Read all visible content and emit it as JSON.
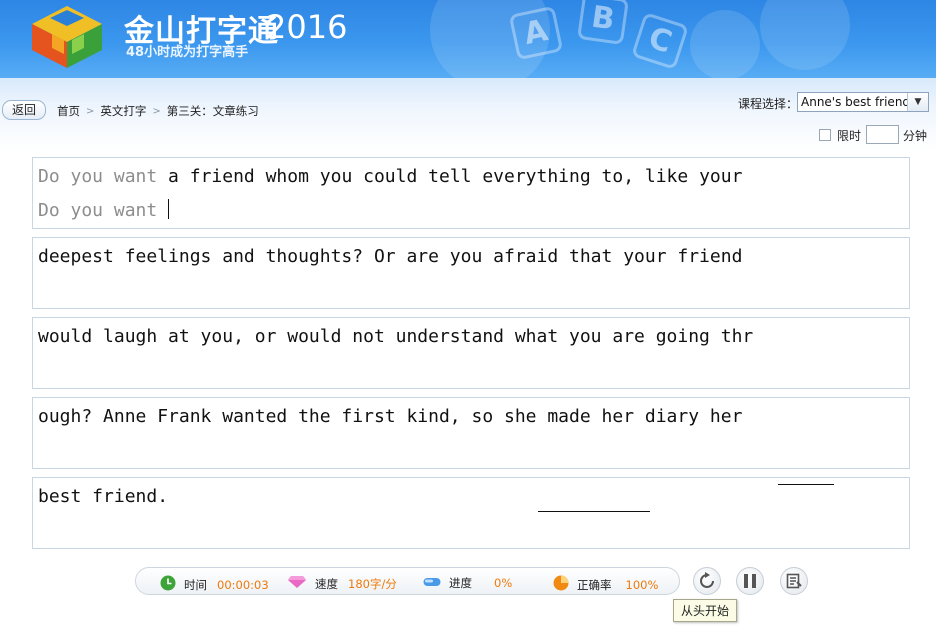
{
  "header": {
    "brand": "金山打字通",
    "year": "2016",
    "slogan": "48小时成为打字高手",
    "deco_letters": [
      "A",
      "B",
      "C"
    ]
  },
  "nav": {
    "back_label": "返回",
    "breadcrumb": [
      "首页",
      "英文打字",
      "第三关：文章练习"
    ],
    "breadcrumb_sep": ">",
    "course_label": "课程选择：",
    "course_value": "Anne's best friend",
    "time_limit_label": "限时",
    "time_limit_value": "",
    "time_limit_unit": "分钟"
  },
  "typing": {
    "lines": [
      {
        "text": "Do you want a friend whom you could tell everything to, like your",
        "typed": "Do you want"
      },
      {
        "text": "deepest feelings and thoughts? Or are you afraid that your friend",
        "typed": ""
      },
      {
        "text": "would laugh at you, or would not understand what you are going thr",
        "typed": ""
      },
      {
        "text": "ough? Anne Frank wanted the first kind, so she made her diary her",
        "typed": ""
      },
      {
        "text": "best friend.",
        "typed": ""
      }
    ]
  },
  "status": {
    "time_label": "时间",
    "time_value": "00:00:03",
    "speed_label": "速度",
    "speed_value": "180字/分",
    "progress_label": "进度",
    "progress_value": "0%",
    "accuracy_label": "正确率",
    "accuracy_value": "100%"
  },
  "controls": {
    "restart_tooltip": "从头开始"
  },
  "colors": {
    "header_blue": "#2e86e4",
    "stat_value": "#ee7a0b",
    "typed_gray": "#8d8d8d"
  }
}
